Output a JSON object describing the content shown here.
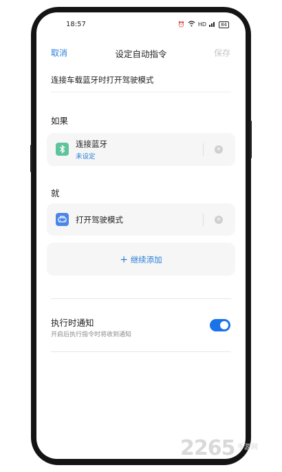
{
  "status_bar": {
    "time": "18:57",
    "alarm_icon": "alarm-icon",
    "wifi_icon": "wifi-icon",
    "hd": "HD",
    "signal": "5G",
    "battery": "84"
  },
  "nav": {
    "cancel": "取消",
    "title": "设定自动指令",
    "save": "保存"
  },
  "command_name": "连接车载蓝牙时打开驾驶模式",
  "if_section": {
    "label": "如果",
    "card": {
      "icon": "bluetooth-icon",
      "icon_color": "#5ec49c",
      "title": "连接蓝牙",
      "subtitle": "未设定"
    }
  },
  "then_section": {
    "label": "就",
    "card": {
      "icon": "car-icon",
      "icon_color": "#4a86e8",
      "title": "打开驾驶模式"
    },
    "add_button": "继续添加"
  },
  "notify": {
    "title": "执行时通知",
    "subtitle": "开启后执行指令时将收到通知",
    "enabled": true
  },
  "watermark": {
    "number": "2265",
    "text": "手游网"
  },
  "colors": {
    "accent": "#2a7fd8",
    "toggle": "#1a73e8"
  }
}
